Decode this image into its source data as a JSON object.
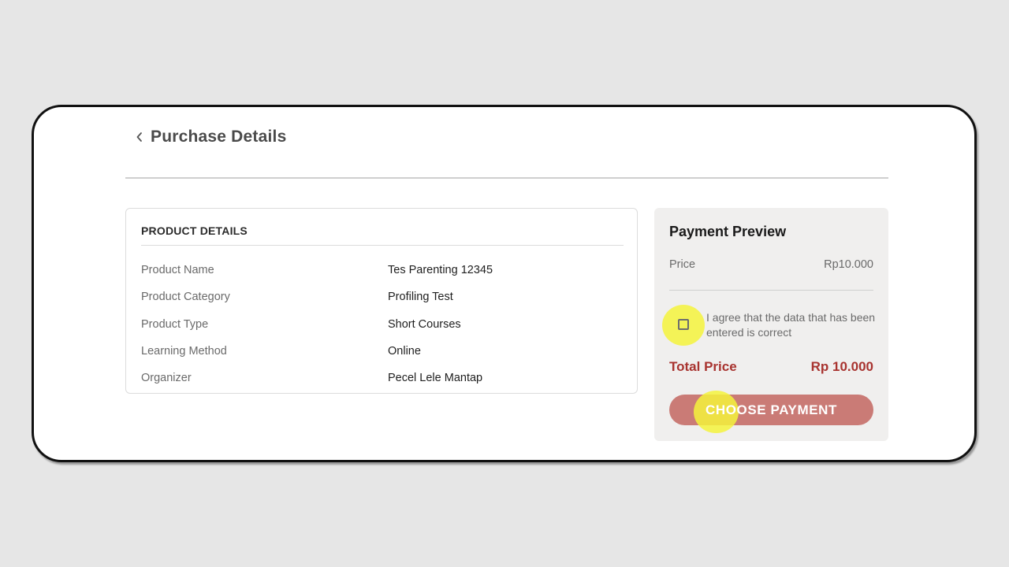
{
  "header": {
    "back_icon": "chevron-left-icon",
    "title": "Purchase Details"
  },
  "product_details": {
    "title": "PRODUCT DETAILS",
    "rows": [
      {
        "label": "Product Name",
        "value": "Tes Parenting 12345"
      },
      {
        "label": "Product Category",
        "value": "Profiling Test"
      },
      {
        "label": "Product Type",
        "value": "Short Courses"
      },
      {
        "label": "Learning Method",
        "value": "Online"
      },
      {
        "label": "Organizer",
        "value": "Pecel Lele Mantap"
      }
    ]
  },
  "payment_preview": {
    "title": "Payment Preview",
    "price_label": "Price",
    "price_value": "Rp10.000",
    "agree_text": "I agree that the data that has been entered is correct",
    "agree_checked": false,
    "total_label": "Total Price",
    "total_value": "Rp 10.000",
    "button_label": "CHOOSE PAYMENT"
  },
  "colors": {
    "accent": "#a8332f",
    "button_disabled": "#ca7b76",
    "highlight": "#f5f33c"
  }
}
